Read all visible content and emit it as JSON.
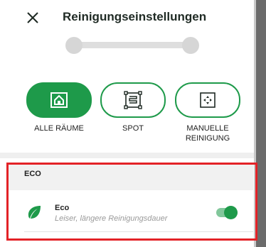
{
  "header": {
    "title": "Reinigungseinstellungen",
    "close_icon": "close-icon"
  },
  "slider": {
    "positions": 2,
    "value_fraction": 0.0
  },
  "modes": [
    {
      "label": "ALLE RÄUME",
      "icon": "house-icon",
      "active": true
    },
    {
      "label": "SPOT",
      "icon": "spot-icon",
      "active": false
    },
    {
      "label": "MANUELLE\nREINIGUNG",
      "icon": "manual-area-icon",
      "active": false
    }
  ],
  "section": {
    "title": "ECO",
    "item": {
      "icon": "leaf-icon",
      "name": "Eco",
      "description": "Leiser, längere Reinigungsdauer",
      "toggle_on": true
    }
  },
  "colors": {
    "accent": "#1e9a4a",
    "highlight_border": "#e32227"
  }
}
